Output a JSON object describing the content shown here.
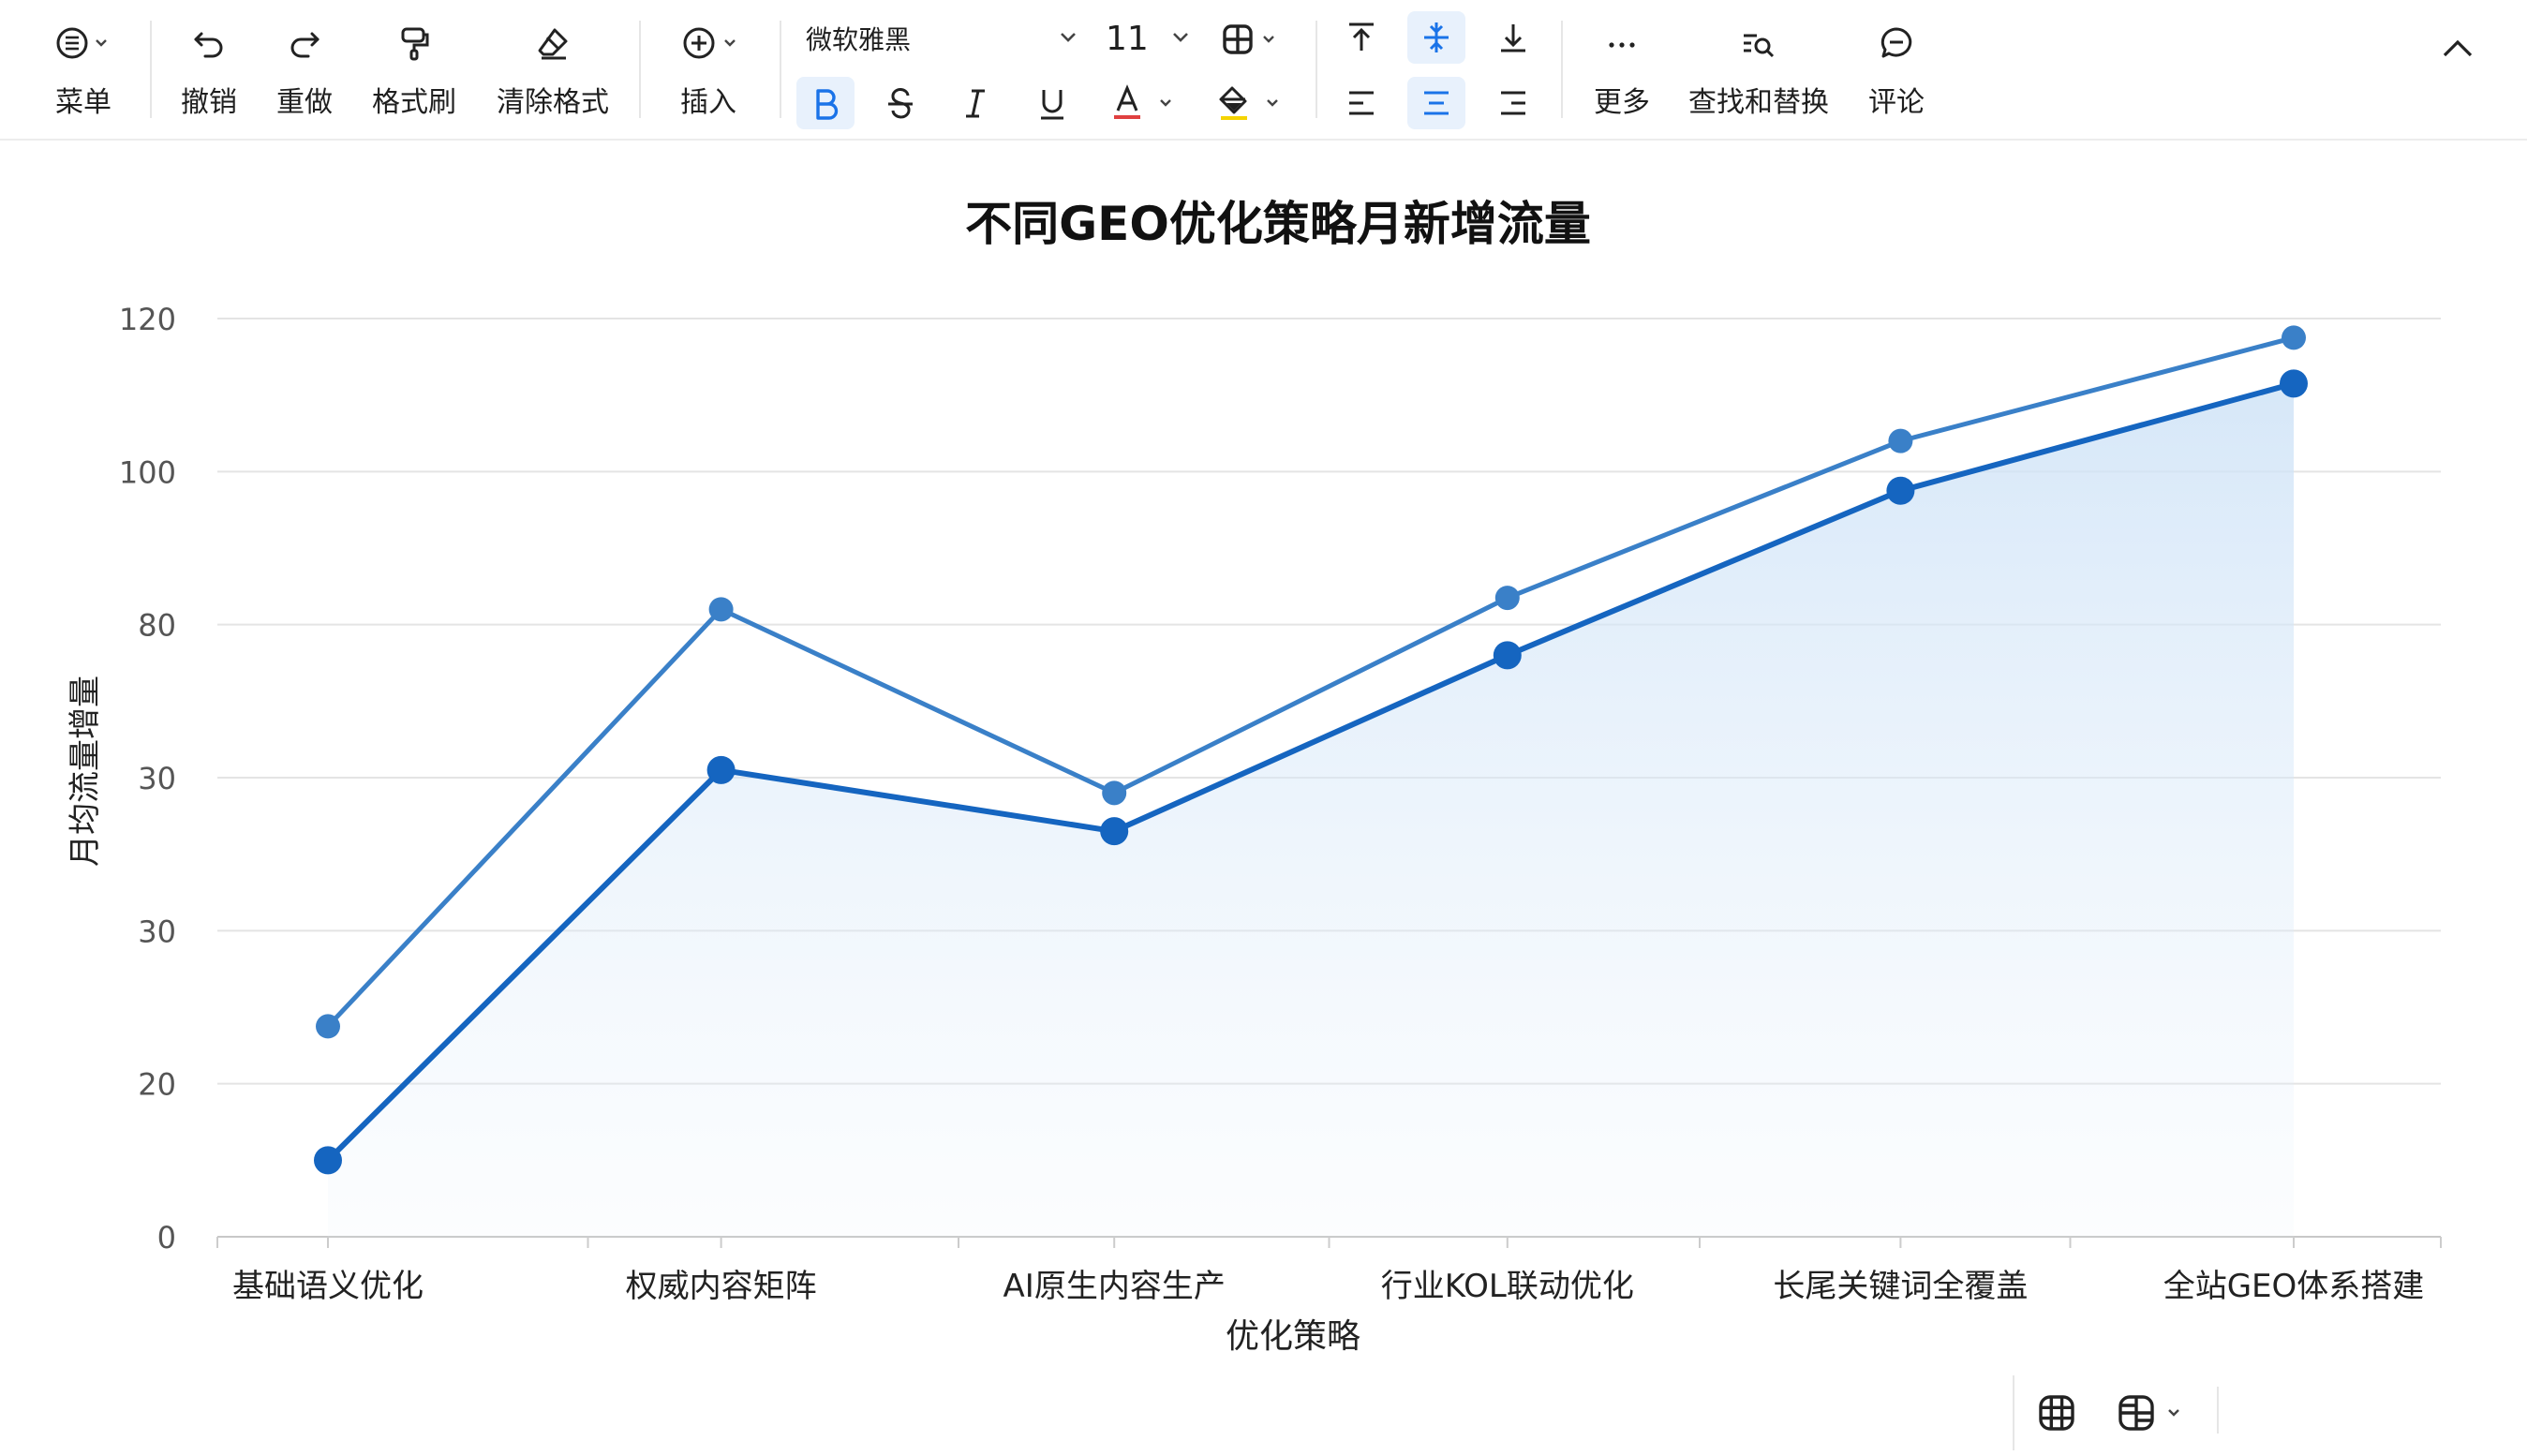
{
  "toolbar": {
    "menu_label": "菜单",
    "undo_label": "撤销",
    "redo_label": "重做",
    "format_painter_label": "格式刷",
    "clear_format_label": "清除格式",
    "insert_label": "插入",
    "font_name": "微软雅黑",
    "font_size": "11",
    "more_label": "更多",
    "find_replace_label": "查找和替换",
    "comment_label": "评论",
    "accent_color": "#1a73e8",
    "font_color_bar": "#e04040",
    "highlight_bar": "#f5d400"
  },
  "chart_data": {
    "type": "line",
    "title": "不同GEO优化策略月新增流量",
    "xlabel": "优化策略",
    "ylabel": "月均流量增量",
    "categories": [
      "基础语义优化",
      "权威内容矩阵",
      "AI原生内容生产",
      "行业KOL联动优化",
      "长尾关键词全覆盖",
      "全站GEO体系搭建"
    ],
    "y_tick_labels": [
      "0",
      "20",
      "30",
      "30",
      "80",
      "100",
      "120"
    ],
    "series": [
      {
        "values": [
          27.5,
          82,
          58,
          83.5,
          104,
          117.5
        ],
        "color": "#3a80c8",
        "fill": false
      },
      {
        "values": [
          10,
          61,
          53,
          76,
          97.5,
          111.5
        ],
        "color": "#1565c0",
        "fill": true
      }
    ],
    "ylim": [
      0,
      120
    ],
    "grid": true,
    "legend": "none"
  }
}
